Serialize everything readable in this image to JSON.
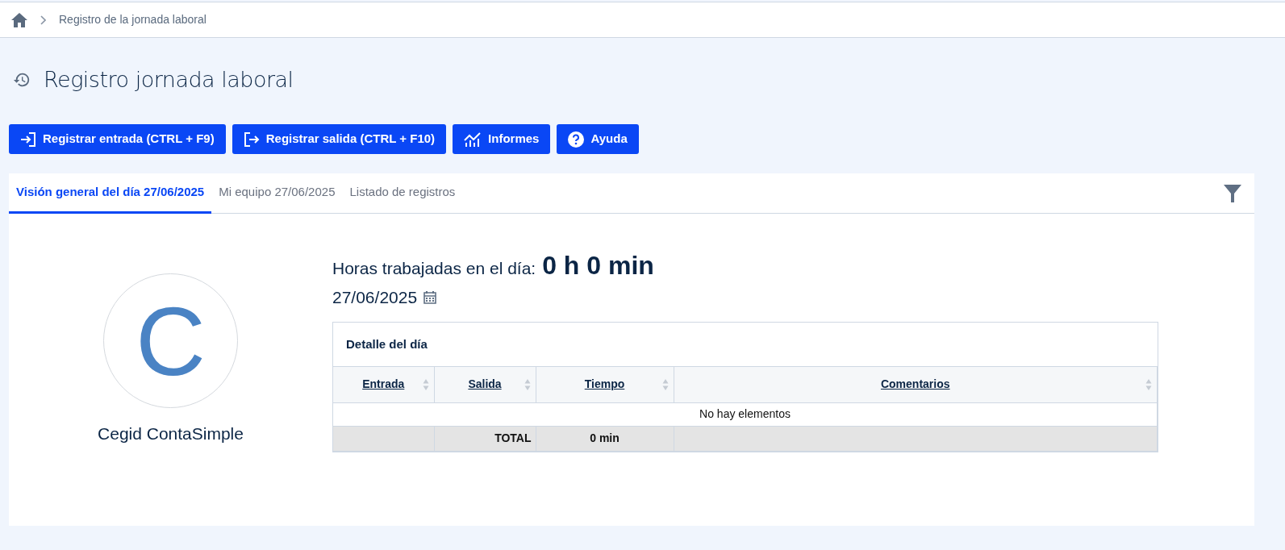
{
  "breadcrumb": {
    "items": [
      "Registro de la jornada laboral"
    ]
  },
  "page_title": "Registro jornada laboral",
  "buttons": [
    {
      "label": "Registrar entrada (CTRL + F9)",
      "kind": "enter"
    },
    {
      "label": "Registrar salida (CTRL + F10)",
      "kind": "exit"
    },
    {
      "label": "Informes",
      "kind": "chart"
    },
    {
      "label": "Ayuda",
      "kind": "help"
    }
  ],
  "tabs": [
    {
      "label": "Visión general del día 27/06/2025",
      "selected": true
    },
    {
      "label": "Mi equipo 27/06/2025",
      "selected": false
    },
    {
      "label": "Listado de registros",
      "selected": false
    }
  ],
  "profile": {
    "initial": "C",
    "name": "Cegid ContaSimple"
  },
  "summary": {
    "label": "Horas trabajadas en el día:",
    "value": "0 h 0 min",
    "date": "27/06/2025"
  },
  "detail": {
    "title": "Detalle del día",
    "columns": [
      "Entrada",
      "Salida",
      "Tiempo",
      "Comentarios"
    ],
    "empty_message": "No hay elementos",
    "total": {
      "label": "TOTAL",
      "value": "0 min"
    }
  }
}
